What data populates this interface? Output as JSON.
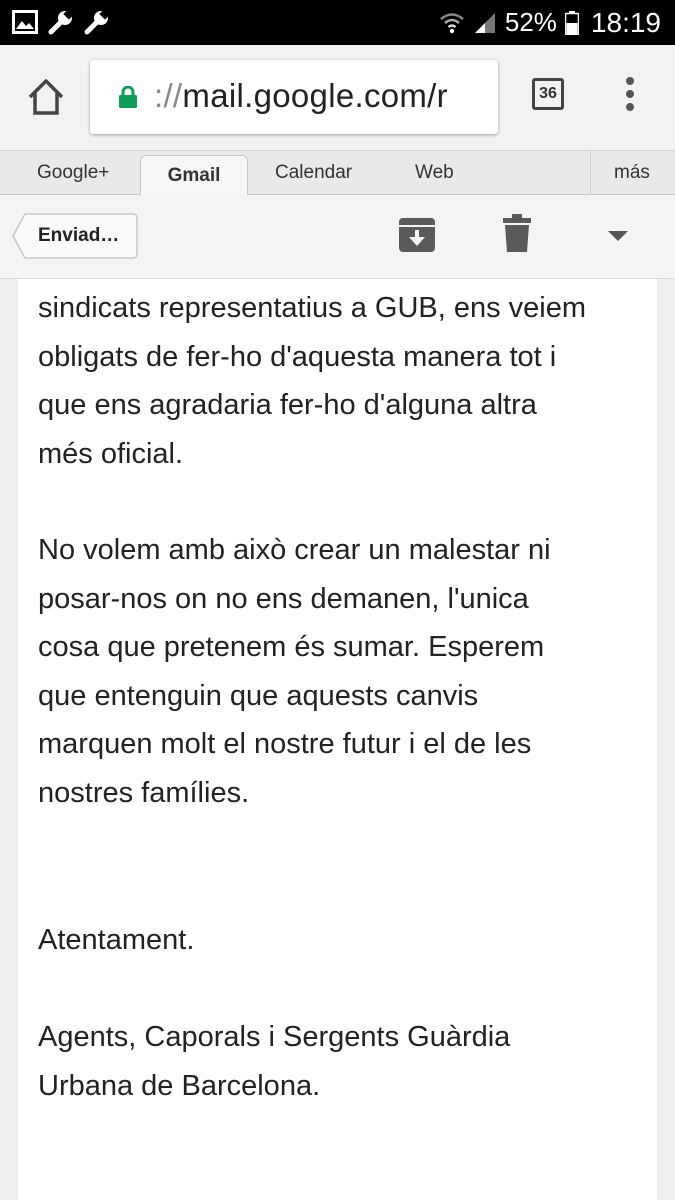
{
  "status_bar": {
    "battery": "52%",
    "time": "18:19",
    "left_icons": [
      "image-icon",
      "wrench-icon",
      "wrench-icon"
    ],
    "right_icons": [
      "wifi-icon",
      "signal-icon",
      "battery-icon"
    ]
  },
  "browser": {
    "url_scheme": "://",
    "url_host": "mail.google.com/r",
    "tab_count": "36"
  },
  "gmail_nav": {
    "tabs": [
      {
        "label": "Google+"
      },
      {
        "label": "Gmail",
        "active": true
      },
      {
        "label": "Calendar"
      },
      {
        "label": "Web"
      },
      {
        "label": "más"
      }
    ]
  },
  "action_bar": {
    "back_label": "Enviad…"
  },
  "message": {
    "paragraphs": [
      "sindicats representatius a GUB, ens veiem\nobligats de fer-ho d'aquesta manera tot i\nque ens agradaria fer-ho d'alguna altra\nmés oficial.",
      "No volem amb això crear un malestar ni\nposar-nos on no ens demanen, l'unica\ncosa que pretenem és sumar. Esperem\nque entenguin que aquests canvis\nmarquen molt el nostre futur i el de les\nnostres famílies.",
      "Atentament.",
      "Agents, Caporals i Sergents Guàrdia\nUrbana de Barcelona."
    ]
  },
  "colors": {
    "lock": "#0f9d58",
    "status_bar_bg": "#000000",
    "page_bg": "#eeeeee"
  }
}
